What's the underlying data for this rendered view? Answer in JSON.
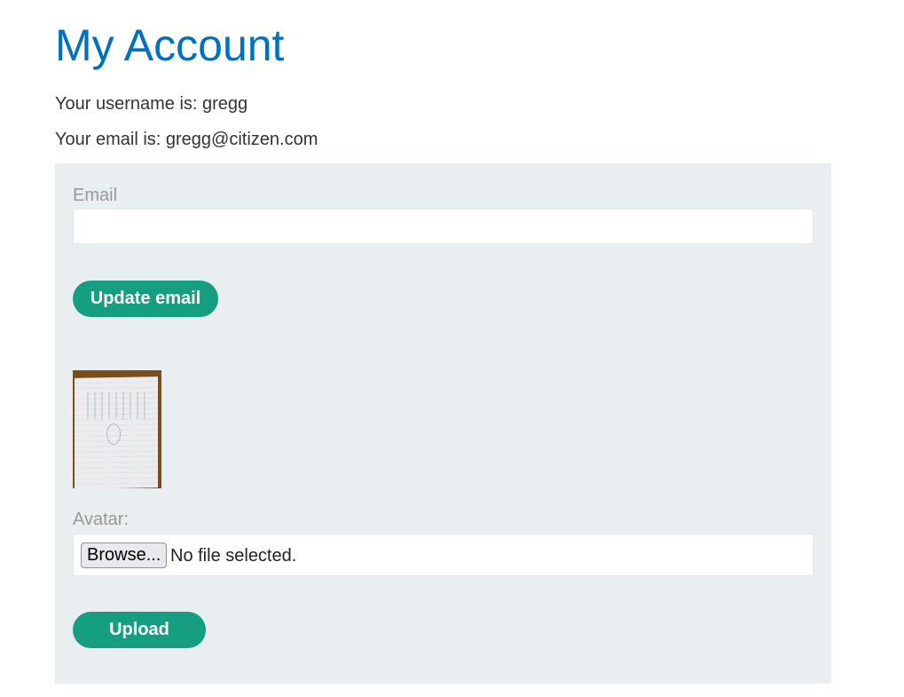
{
  "page": {
    "title": "My Account"
  },
  "account": {
    "username_text": "Your username is: gregg",
    "email_text": "Your email is: gregg@citizen.com"
  },
  "email_form": {
    "label": "Email",
    "value": "",
    "placeholder": "",
    "submit_label": "Update email"
  },
  "avatar_form": {
    "label": "Avatar:",
    "browse_label": "Browse...",
    "file_status": "No file selected.",
    "submit_label": "Upload"
  },
  "colors": {
    "title": "#0071bc",
    "text": "#333332",
    "panel_background": "#e9eef0",
    "label": "#999999",
    "button": "#159e7f",
    "button_text": "#ffffff"
  }
}
